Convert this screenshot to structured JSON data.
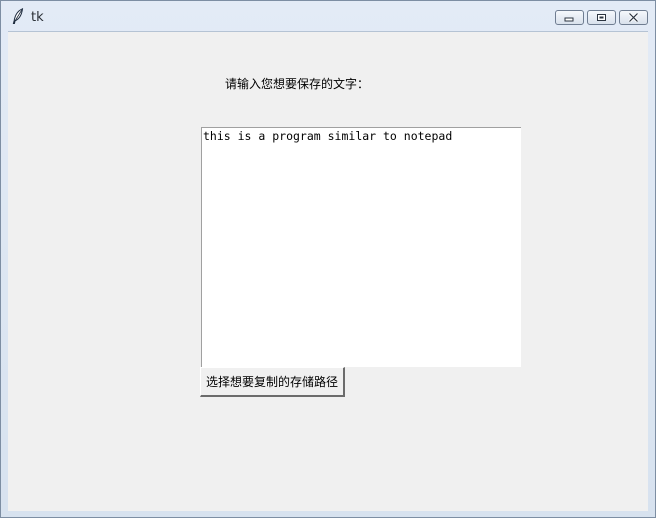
{
  "window": {
    "title": "tk",
    "icon": "feather-icon",
    "controls": [
      "minimize-icon",
      "maximize-icon",
      "close-icon"
    ]
  },
  "main": {
    "prompt_label": "请输入您想要保存的文字：",
    "text_content": "this is a program similar to notepad",
    "path_button_label": "选择想要复制的存储路径"
  }
}
